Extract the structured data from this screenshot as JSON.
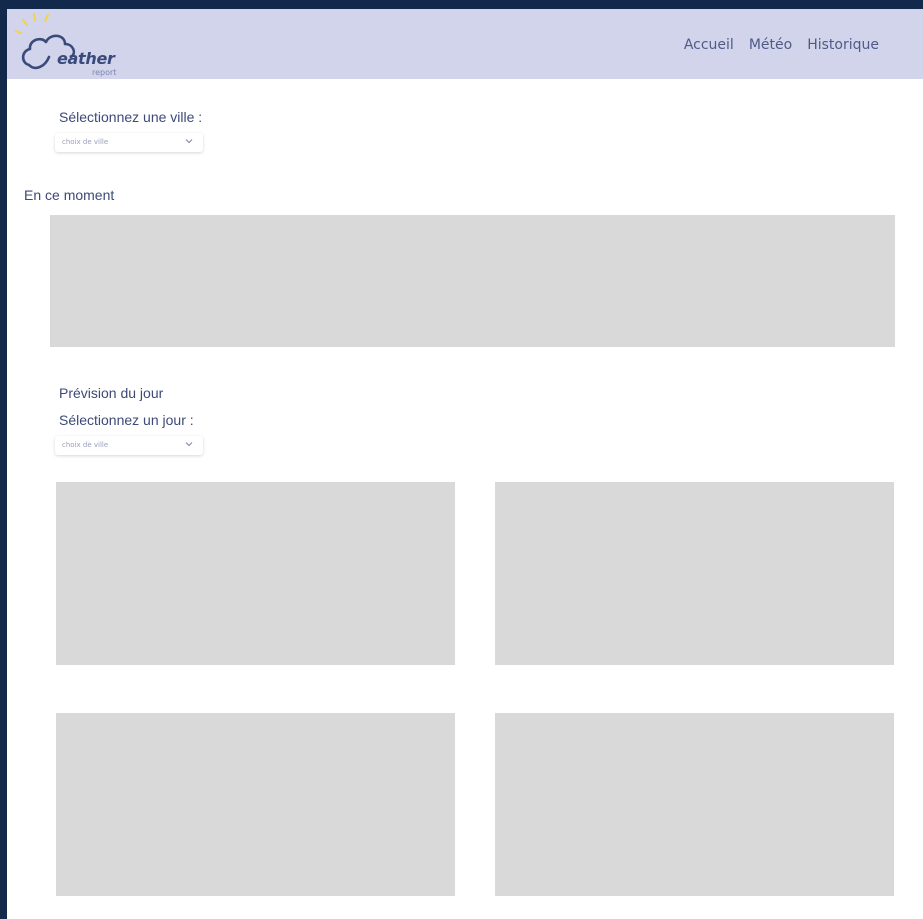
{
  "app": {
    "logo_word": "eather",
    "logo_sub": "report"
  },
  "nav": {
    "items": [
      "Accueil",
      "Météo",
      "Historique"
    ]
  },
  "city_select": {
    "label": "Sélectionnez une ville :",
    "placeholder": "choix de ville"
  },
  "current": {
    "title": "En ce moment"
  },
  "forecast": {
    "title": "Prévision du jour",
    "day_select": {
      "label": "Sélectionnez un jour :",
      "placeholder": "choix de ville"
    }
  },
  "colors": {
    "header_bg": "#d1d4ea",
    "frame_bg": "#13294b",
    "placeholder_box": "#d9d9d9",
    "text": "#3d4a78",
    "sun": "#f5d24a"
  }
}
